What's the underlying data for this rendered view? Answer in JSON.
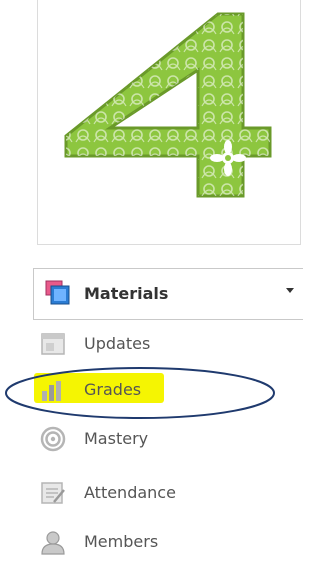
{
  "course_logo": {
    "digit": "4",
    "primary_color": "#8dc63f",
    "outline_color": "#6a9a2a"
  },
  "materials_menu": {
    "label": "Materials",
    "icon": "materials-icon"
  },
  "nav": {
    "items": [
      {
        "label": "Updates",
        "icon": "updates-icon"
      },
      {
        "label": "Grades",
        "icon": "grades-icon",
        "highlighted": true
      },
      {
        "label": "Mastery",
        "icon": "mastery-icon"
      },
      {
        "label": "Attendance",
        "icon": "attendance-icon"
      },
      {
        "label": "Members",
        "icon": "members-icon"
      }
    ]
  },
  "annotation": {
    "highlight_color": "#f5f502",
    "ellipse_color": "#1f3a6e"
  }
}
